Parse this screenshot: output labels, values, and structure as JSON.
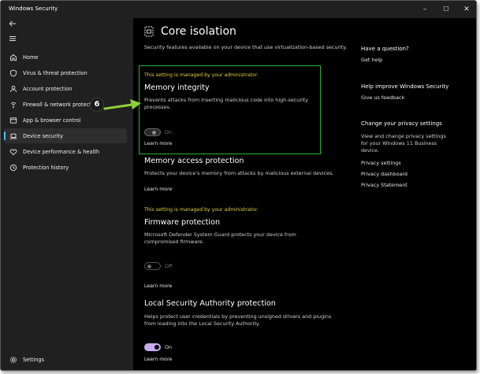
{
  "window": {
    "title": "Windows Security",
    "controls": {
      "minimize": "–",
      "maximize": "☐",
      "close": "✕"
    }
  },
  "sidebar": {
    "items": [
      {
        "label": "Home",
        "icon": "home-icon"
      },
      {
        "label": "Virus & threat protection",
        "icon": "shield-icon"
      },
      {
        "label": "Account protection",
        "icon": "person-icon"
      },
      {
        "label": "Firewall & network protection",
        "icon": "wifi-icon"
      },
      {
        "label": "App & browser control",
        "icon": "browser-icon"
      },
      {
        "label": "Device security",
        "icon": "laptop-icon",
        "selected": true
      },
      {
        "label": "Device performance & health",
        "icon": "heart-icon"
      },
      {
        "label": "Protection history",
        "icon": "history-icon"
      }
    ],
    "settings_label": "Settings"
  },
  "main": {
    "title": "Core isolation",
    "intro": "Security features available on your device that use virtualization-based security.",
    "managed_notice": "This setting is managed by your administrator.",
    "memory_integrity": {
      "title": "Memory integrity",
      "desc": "Prevents attacks from inserting malicious code into high-security processes.",
      "toggle_label": "On",
      "learn_more": "Learn more"
    },
    "memory_access": {
      "title": "Memory access protection",
      "desc": "Protects your device's memory from attacks by malicious external devices.",
      "learn_more": "Learn more"
    },
    "firmware": {
      "title": "Firmware protection",
      "desc": "Microsoft Defender System Guard protects your device from compromised firmware.",
      "toggle_label": "Off",
      "learn_more": "Learn more"
    },
    "lsa": {
      "title": "Local Security Authority protection",
      "desc": "Helps protect user credentials by preventing unsigned drivers and plugins from loading into the Local Security Authority.",
      "toggle_label": "On",
      "learn_more": "Learn more"
    }
  },
  "right": {
    "question_title": "Have a question?",
    "get_help": "Get help",
    "improve_title": "Help improve Windows Security",
    "feedback": "Give us feedback",
    "privacy_title": "Change your privacy settings",
    "privacy_desc": "View and change privacy settings for your Windows 11 Business device.",
    "privacy_links": [
      "Privacy settings",
      "Privacy dashboard",
      "Privacy Statement"
    ]
  },
  "annotation": {
    "step": "6"
  },
  "colors": {
    "accent": "#4cc2ff",
    "managed_text": "#e2d23a",
    "highlight_border": "#2fb02f",
    "toggle_on": "#c7a9ec"
  }
}
